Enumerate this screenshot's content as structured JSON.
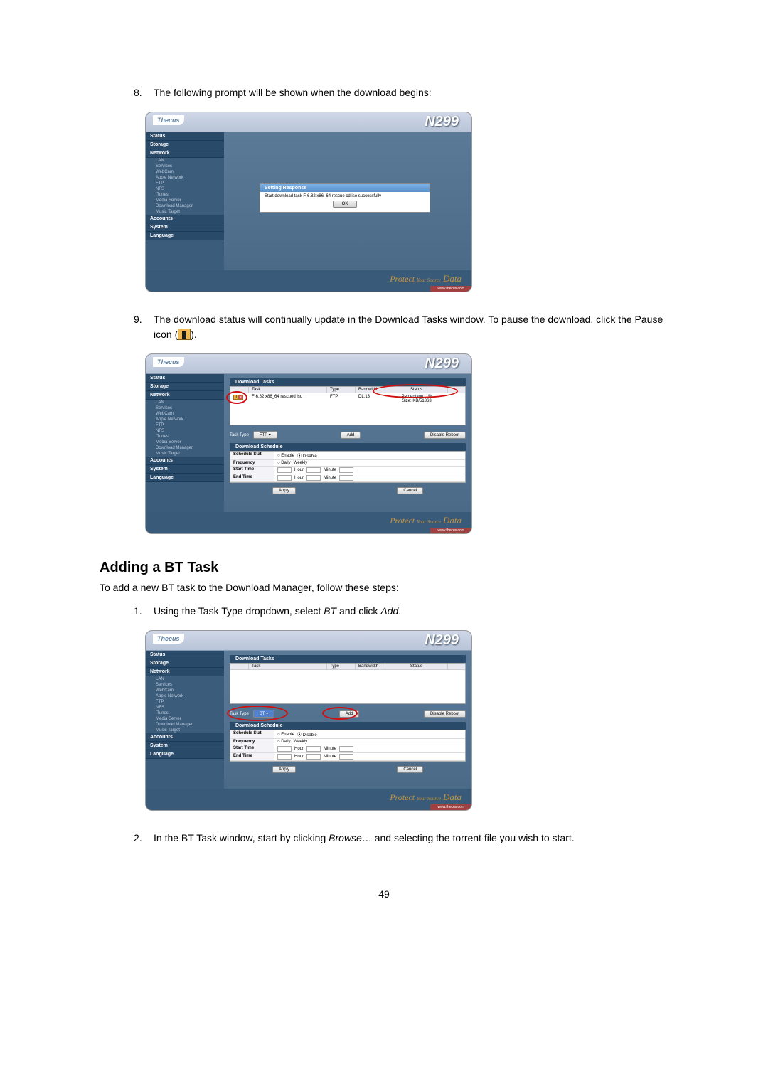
{
  "product_name": "N299",
  "logo_text": "Thecus",
  "footer_tagline_prefix": "Protect ",
  "footer_tagline_small": "Your Source",
  "footer_tagline_data": "Data",
  "footer_link": "www.thecus.com",
  "sidebar_headers": [
    "Status",
    "Storage",
    "Network"
  ],
  "sidebar_items": [
    "LAN",
    "Services",
    "WebCam",
    "Apple Network",
    "FTP",
    "NFS",
    "iTunes",
    "Media Server",
    "Download Manager",
    "Music Target"
  ],
  "sidebar_footer_headers": [
    "Accounts",
    "System",
    "Language"
  ],
  "step8": {
    "number": "8.",
    "text": "The following prompt will be shown when the download begins:",
    "dialog_title": "Setting Response",
    "dialog_msg": "Start download task F-6.82 x86_64 rescue cd iso successfully",
    "ok": "OK"
  },
  "step9": {
    "number": "9.",
    "text_before": "The download status will continually update in the Download Tasks window. To pause the download, click the Pause icon (",
    "text_after": ").",
    "download_tasks_title": "Download Tasks",
    "download_schedule_title": "Download Schedule",
    "columns": {
      "task": "Task",
      "type": "Type",
      "bandwidth": "Bandwidth",
      "status": "Status"
    },
    "task_row": {
      "task": "F-6.82 x86_64 rescued iso",
      "type": "FTP",
      "bandwidth": "DL:13",
      "status1": "Percentage: 1%",
      "status2": "Size: KB/51363"
    },
    "task_type_label": "Task Type",
    "task_type_value": "FTP",
    "add_btn": "Add",
    "disable_reboot": "Disable Reboot",
    "schedule": {
      "stat": "Schedule Stat",
      "enable": "Enable",
      "disable": "Disable",
      "freq": "Frequency",
      "daily": "Daily",
      "weekly": "Weekly",
      "start": "Start Time",
      "hour": "Hour",
      "minute": "Minute",
      "end": "End Time"
    },
    "apply": "Apply",
    "cancel": "Cancel"
  },
  "section_bt": {
    "heading": "Adding a BT Task",
    "intro": "To add a new BT task to the Download Manager, follow these steps:"
  },
  "bt_step1": {
    "number": "1.",
    "text_a": "Using the Task Type dropdown, select ",
    "italic_bt": "BT",
    "text_b": " and click ",
    "italic_add": "Add",
    "text_c": ".",
    "task_type_value": "BT"
  },
  "bt_step2": {
    "number": "2.",
    "text_a": "In the BT Task window, start by clicking ",
    "italic_browse": "Browse",
    "text_b": "… and selecting the torrent file you wish to start."
  },
  "page_number": "49"
}
